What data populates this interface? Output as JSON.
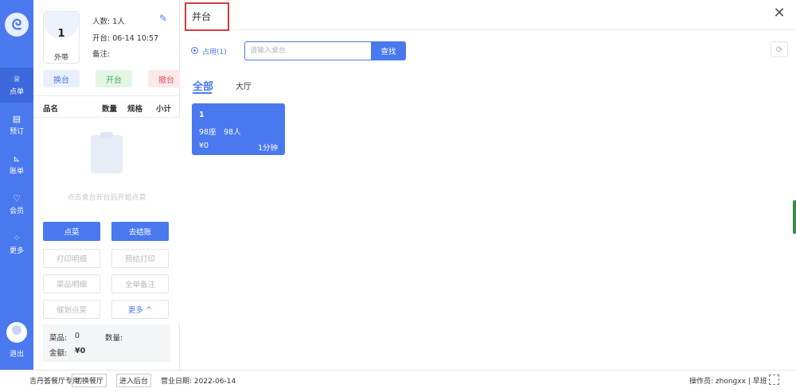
{
  "nav": {
    "items": [
      {
        "icon": "chef-hat-icon",
        "label": "点单"
      },
      {
        "icon": "book-icon",
        "label": "预订"
      },
      {
        "icon": "chart-icon",
        "label": "账单"
      },
      {
        "icon": "member-icon",
        "label": "会员"
      },
      {
        "icon": "grid-icon",
        "label": "更多"
      }
    ],
    "logout": "退出",
    "accent": "#4a78ee"
  },
  "order_panel": {
    "table_number": "1",
    "table_type": "外带",
    "people": "人数: 1人",
    "open_time": "开台: 06-14 10:57",
    "note": "备注:",
    "actions": {
      "change": "换台",
      "open": "开台",
      "cancel": "撤台"
    },
    "columns": {
      "name": "品名",
      "qty": "数量",
      "spec": "规格",
      "subtotal": "小计"
    },
    "empty_text": "点击桌台开台后开始点菜",
    "buttons": {
      "order": "点菜",
      "checkout": "去结账",
      "print_detail": "打印明细",
      "pre_print": "预结打印",
      "dish_detail": "菜品明细",
      "whole_note": "全单备注",
      "rush": "催划点菜",
      "more": "更多 ^"
    },
    "summary": {
      "dishes_label": "菜品:",
      "dishes_value": "0",
      "qty_label": "数量:",
      "amount_label": "金额:",
      "amount_value": "¥0"
    }
  },
  "modal": {
    "title": "并台",
    "radio_label": "占用(1)",
    "search_placeholder": "请输入桌台",
    "search_button": "查找",
    "tabs": [
      "全部",
      "大厅"
    ],
    "table_card": {
      "number": "1",
      "seats": "98座",
      "people": "98人",
      "amount": "¥0",
      "duration": "1分钟"
    }
  },
  "status_bar": {
    "store": "吉丹荟餐厅专用",
    "switch_store": "切换餐厅",
    "enter_backend": "进入后台",
    "business_date": "营业日期: 2022-06-14",
    "operator": "操作员: zhongxx | 早班"
  }
}
